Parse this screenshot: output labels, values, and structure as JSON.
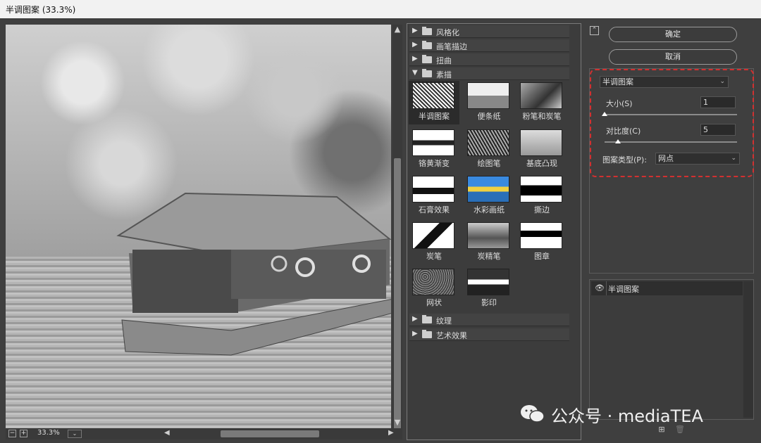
{
  "window": {
    "title": "半调图案 (33.3%)"
  },
  "preview": {
    "zoom": "33.3%",
    "zoom_out": "−",
    "zoom_in": "+",
    "zoom_dropdown": "⌄"
  },
  "gallery": {
    "categories_top": [
      {
        "label": "风格化",
        "expanded": false
      },
      {
        "label": "画笔描边",
        "expanded": false
      },
      {
        "label": "扭曲",
        "expanded": false
      },
      {
        "label": "素描",
        "expanded": true
      }
    ],
    "sketch_filters": [
      "半调图案",
      "便条纸",
      "粉笔和炭笔",
      "铬黄渐变",
      "绘图笔",
      "基底凸现",
      "石膏效果",
      "水彩画纸",
      "撕边",
      "炭笔",
      "炭精笔",
      "图章",
      "网状",
      "影印"
    ],
    "selected_filter": "半调图案",
    "categories_bottom": [
      {
        "label": "纹理",
        "expanded": false
      },
      {
        "label": "艺术效果",
        "expanded": false
      }
    ]
  },
  "actions": {
    "collapse": "⌃",
    "ok": "确定",
    "cancel": "取消"
  },
  "settings": {
    "filter_select": "半调图案",
    "size": {
      "label": "大小(S)",
      "value": "1",
      "level": 0.0
    },
    "contrast": {
      "label": "对比度(C)",
      "value": "5",
      "level": 0.1
    },
    "pattern_type": {
      "label": "图案类型(P):",
      "value": "网点"
    }
  },
  "layers": {
    "items": [
      {
        "name": "半调图案",
        "visible": true
      }
    ],
    "new_layer": "⊞",
    "delete_layer": "🗑"
  },
  "watermark": {
    "text": "公众号 · mediaTEA"
  }
}
